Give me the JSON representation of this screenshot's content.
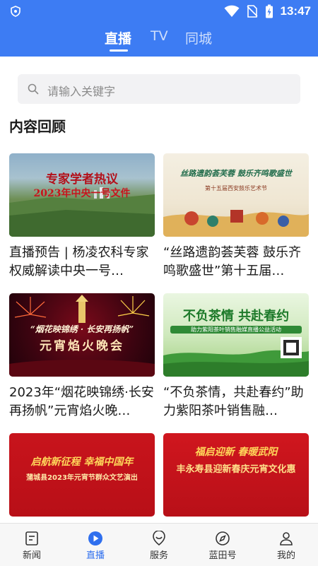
{
  "status_bar": {
    "time": "13:47"
  },
  "top_tabs": [
    {
      "label": "直播",
      "active": true
    },
    {
      "label": "TV",
      "active": false
    },
    {
      "label": "同城",
      "active": false
    }
  ],
  "search": {
    "placeholder": "请输入关键字"
  },
  "section": {
    "title": "内容回顾"
  },
  "cards": [
    {
      "title": "直播预告 | 杨凌农科专家权威解读中央一号…",
      "thumb_title": "专家学者热议",
      "thumb_subtitle": "2023年中央一号文件"
    },
    {
      "title": "“丝路遗韵荟芙蓉 鼓乐齐鸣歌盛世”第十五届…",
      "thumb_title": "丝路遗韵荟芙蓉  鼓乐齐鸣歌盛世",
      "thumb_subtitle": "第十五届西安鼓乐艺术节"
    },
    {
      "title": "2023年“烟花映锦绣·长安再扬帆”元宵焰火晚…",
      "thumb_title": "“烟花映锦绣 · 长安再扬帆”",
      "thumb_subtitle": "元宵焰火晚会"
    },
    {
      "title": "“不负茶情，共赴春约”助力紫阳茶叶销售融…",
      "thumb_title": "不负茶情 共赴春约",
      "thumb_subtitle": "助力紫阳茶叶销售融媒直播公益活动"
    },
    {
      "title": "",
      "thumb_title": "启航新征程  幸福中国年",
      "thumb_subtitle": "蒲城县2023年元宵节群众文艺演出"
    },
    {
      "title": "",
      "thumb_title": "福启迎新  春暖武阳",
      "thumb_subtitle": "丰永寿县迎新春庆元宵文化惠"
    }
  ],
  "bottom_nav": [
    {
      "label": "新闻",
      "icon": "news-icon",
      "active": false
    },
    {
      "label": "直播",
      "icon": "live-play-icon",
      "active": true
    },
    {
      "label": "服务",
      "icon": "service-icon",
      "active": false
    },
    {
      "label": "蓝田号",
      "icon": "compass-icon",
      "active": false
    },
    {
      "label": "我的",
      "icon": "person-icon",
      "active": false
    }
  ],
  "colors": {
    "brand_blue": "#3d7cf3",
    "active_nav": "#2f6fee",
    "festive_red": "#c8141c"
  }
}
